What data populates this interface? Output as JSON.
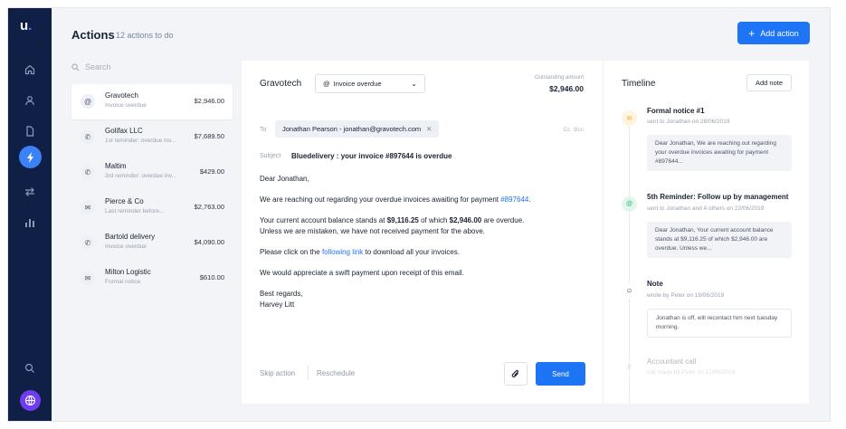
{
  "app": {
    "logo": "u",
    "logo_dot": "."
  },
  "sidebar": {
    "icons": [
      "home-icon",
      "user-icon",
      "document-icon",
      "bolt-icon",
      "transfer-icon",
      "chart-icon",
      "chat-icon"
    ],
    "active": "bolt-icon",
    "avatar_icon": "globe-icon"
  },
  "header": {
    "title": "Actions",
    "count": "12 actions to do",
    "add_button": "Add action",
    "add_icon": "+"
  },
  "search": {
    "placeholder": "Search"
  },
  "actions": [
    {
      "name": "Gravotech",
      "sub": "Invoice overdue",
      "amount": "$2,946.00",
      "icon": "at-icon",
      "glyph": "@"
    },
    {
      "name": "Golifax LLC",
      "sub": "1st reminder: overdue inv...",
      "amount": "$7,689.50",
      "icon": "phone-icon",
      "glyph": "✆"
    },
    {
      "name": "Maltim",
      "sub": "3rd reminder: overdue inv...",
      "amount": "$429.00",
      "icon": "phone-icon",
      "glyph": "✆"
    },
    {
      "name": "Pierce & Co",
      "sub": "Last reminder before...",
      "amount": "$2,763.00",
      "icon": "mail-icon",
      "glyph": "✉"
    },
    {
      "name": "Bartold delivery",
      "sub": "Invoice overdue",
      "amount": "$4,090.00",
      "icon": "phone-icon",
      "glyph": "✆"
    },
    {
      "name": "Milton Logistic",
      "sub": "Formal notice",
      "amount": "$610.00",
      "icon": "mail-icon",
      "glyph": "✉"
    }
  ],
  "email": {
    "company": "Gravotech",
    "template": "Invoice overdue",
    "template_glyph": "@",
    "outstanding_label": "Outstanding amount",
    "outstanding_value": "$2,946.00",
    "to_label": "To",
    "recipient": "Jonathan Pearson - jonathan@gravotech.com",
    "cc": "Cc",
    "bcc": "Bcc",
    "subject_label": "Subject",
    "subject": "Bluedelivery : your invoice #897644 is overdue",
    "greeting": "Dear Jonathan,",
    "p1_text": "We are reaching out regarding your overdue invoices awaiting for payment ",
    "p1_link": "#897644",
    "p1_end": ".",
    "p2_a": "Your current account balance stands at ",
    "p2_b": "$9,116.25",
    "p2_c": " of which ",
    "p2_d": "$2,946.00",
    "p2_e": " are overdue.",
    "p2_line2": "Unless we are mistaken, we have not received payment for the above.",
    "p3_a": "Please click on the ",
    "p3_link": "following link",
    "p3_b": " to download all your invoices.",
    "p4": "We would appreciate a swift payment upon receipt of this email.",
    "closing": "Best regards,",
    "signature": "Harvey Litt",
    "skip": "Skip action",
    "reschedule": "Reschedule",
    "send": "Send"
  },
  "timeline": {
    "title": "Timeline",
    "add_note": "Add note",
    "events": [
      {
        "title": "Formal notice #1",
        "meta": "sent to Jonathan on 28/06/2019",
        "text": "Dear Jonathan, We are reaching out regarding your overdue invoices awaiting for payment #897644...",
        "icon": "mail-icon",
        "color": "#f5a623",
        "bg": "#fff4e0"
      },
      {
        "title": "5th Reminder: Follow up by management",
        "meta": "sent to Jonathan and 4 others on 22/06/2019",
        "text": "Dear Jonathan, Your current account balance stands at $9,116.25 of which $2,946.00 are overdue. Unless we...",
        "icon": "at-icon",
        "color": "#1fb37a",
        "bg": "#e2f6ec"
      },
      {
        "title": "Note",
        "meta": "wrote by Peter on 19/06/2019",
        "text": "Jonathan is off, will recontact him next tuesday morning.",
        "icon": "comment-icon",
        "color": "#1a2233",
        "bg": "#ffffff"
      },
      {
        "title": "Accountant call",
        "meta": "call made by Peter on 12/06/2019",
        "icon": "phone-icon"
      }
    ]
  }
}
